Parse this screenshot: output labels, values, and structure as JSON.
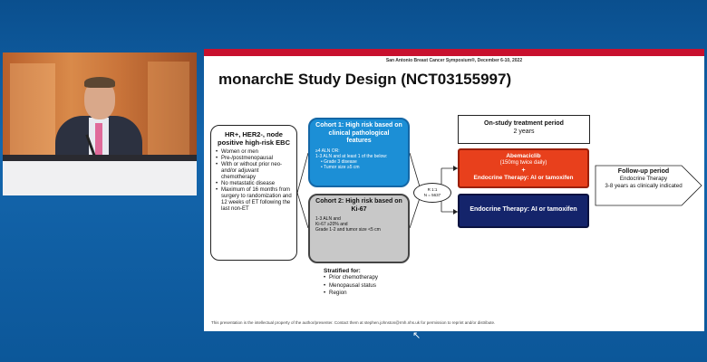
{
  "conference": "San Antonio Breast Cancer Symposium®, December 6-10, 2022",
  "slide_title": "monarchE Study Design (NCT03155997)",
  "ebc": {
    "heading": "HR+, HER2-, node positive high-risk EBC",
    "items": [
      "Women or men",
      "Pre-/postmenopausal",
      "With or without prior neo- and/or adjuvant chemotherapy",
      "No metastatic disease",
      "Maximum of 16 months from surgery to randomization and 12 weeks of ET following the last non-ET"
    ]
  },
  "cohort1": {
    "heading": "Cohort 1: High risk based on clinical pathological features",
    "items": [
      "≥4 ALN OR:",
      "1-3 ALN and at least 1 of the below:",
      "• Grade 3 disease",
      "• Tumor size ≥5 cm"
    ]
  },
  "cohort2": {
    "heading": "Cohort 2: High risk based on Ki-67",
    "items": [
      "1-3 ALN and",
      "Ki-67 ≥20% and",
      "Grade 1-2 and tumor size <5 cm"
    ]
  },
  "stratified": {
    "heading": "Stratified for:",
    "items": [
      "Prior chemotherapy",
      "Menopausal status",
      "Region"
    ]
  },
  "randomization": {
    "ratio": "R 1:1",
    "n": "N = 5637"
  },
  "on_study": {
    "title": "On-study treatment period",
    "duration": "2 years"
  },
  "arm_abema": {
    "drug": "Abemaciclib",
    "dose": "(150mg twice daily)",
    "plus": "+",
    "et": "Endocrine Therapy: AI or tamoxifen"
  },
  "arm_et": {
    "label": "Endocrine Therapy: AI or tamoxifen"
  },
  "follow_up": {
    "title": "Follow-up period",
    "line1": "Endocrine Therapy",
    "line2": "3-8 years as clinically indicated"
  },
  "footer": "This presentation is the intellectual property of the author/presenter. Contact them at stephen.johnston@rmh.nhs.uk for permission to reprint and/or distribute.",
  "colors": {
    "background": "#0e5a9c",
    "cohort1": "#1c8fd6",
    "cohort2": "#c8c8c8",
    "abemaciclib_arm": "#e8401c",
    "et_arm": "#14246b",
    "accent_bar": "#c8102e"
  },
  "icons": {
    "cursor": "mouse-pointer-icon"
  }
}
